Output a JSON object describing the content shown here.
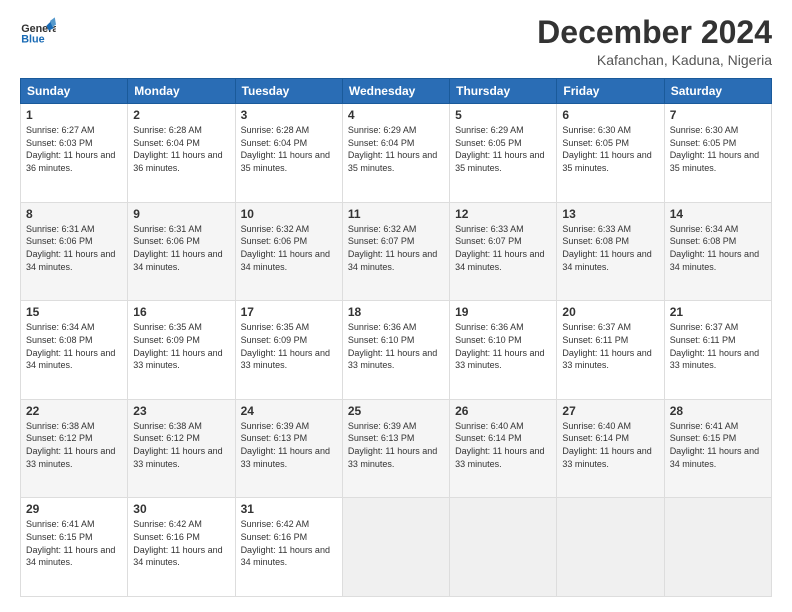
{
  "header": {
    "logo_line1": "General",
    "logo_line2": "Blue",
    "month": "December 2024",
    "location": "Kafanchan, Kaduna, Nigeria"
  },
  "days_of_week": [
    "Sunday",
    "Monday",
    "Tuesday",
    "Wednesday",
    "Thursday",
    "Friday",
    "Saturday"
  ],
  "weeks": [
    [
      {
        "day": "1",
        "sunrise": "6:27 AM",
        "sunset": "6:03 PM",
        "daylight": "11 hours and 36 minutes."
      },
      {
        "day": "2",
        "sunrise": "6:28 AM",
        "sunset": "6:04 PM",
        "daylight": "11 hours and 36 minutes."
      },
      {
        "day": "3",
        "sunrise": "6:28 AM",
        "sunset": "6:04 PM",
        "daylight": "11 hours and 35 minutes."
      },
      {
        "day": "4",
        "sunrise": "6:29 AM",
        "sunset": "6:04 PM",
        "daylight": "11 hours and 35 minutes."
      },
      {
        "day": "5",
        "sunrise": "6:29 AM",
        "sunset": "6:05 PM",
        "daylight": "11 hours and 35 minutes."
      },
      {
        "day": "6",
        "sunrise": "6:30 AM",
        "sunset": "6:05 PM",
        "daylight": "11 hours and 35 minutes."
      },
      {
        "day": "7",
        "sunrise": "6:30 AM",
        "sunset": "6:05 PM",
        "daylight": "11 hours and 35 minutes."
      }
    ],
    [
      {
        "day": "8",
        "sunrise": "6:31 AM",
        "sunset": "6:06 PM",
        "daylight": "11 hours and 34 minutes."
      },
      {
        "day": "9",
        "sunrise": "6:31 AM",
        "sunset": "6:06 PM",
        "daylight": "11 hours and 34 minutes."
      },
      {
        "day": "10",
        "sunrise": "6:32 AM",
        "sunset": "6:06 PM",
        "daylight": "11 hours and 34 minutes."
      },
      {
        "day": "11",
        "sunrise": "6:32 AM",
        "sunset": "6:07 PM",
        "daylight": "11 hours and 34 minutes."
      },
      {
        "day": "12",
        "sunrise": "6:33 AM",
        "sunset": "6:07 PM",
        "daylight": "11 hours and 34 minutes."
      },
      {
        "day": "13",
        "sunrise": "6:33 AM",
        "sunset": "6:08 PM",
        "daylight": "11 hours and 34 minutes."
      },
      {
        "day": "14",
        "sunrise": "6:34 AM",
        "sunset": "6:08 PM",
        "daylight": "11 hours and 34 minutes."
      }
    ],
    [
      {
        "day": "15",
        "sunrise": "6:34 AM",
        "sunset": "6:08 PM",
        "daylight": "11 hours and 34 minutes."
      },
      {
        "day": "16",
        "sunrise": "6:35 AM",
        "sunset": "6:09 PM",
        "daylight": "11 hours and 33 minutes."
      },
      {
        "day": "17",
        "sunrise": "6:35 AM",
        "sunset": "6:09 PM",
        "daylight": "11 hours and 33 minutes."
      },
      {
        "day": "18",
        "sunrise": "6:36 AM",
        "sunset": "6:10 PM",
        "daylight": "11 hours and 33 minutes."
      },
      {
        "day": "19",
        "sunrise": "6:36 AM",
        "sunset": "6:10 PM",
        "daylight": "11 hours and 33 minutes."
      },
      {
        "day": "20",
        "sunrise": "6:37 AM",
        "sunset": "6:11 PM",
        "daylight": "11 hours and 33 minutes."
      },
      {
        "day": "21",
        "sunrise": "6:37 AM",
        "sunset": "6:11 PM",
        "daylight": "11 hours and 33 minutes."
      }
    ],
    [
      {
        "day": "22",
        "sunrise": "6:38 AM",
        "sunset": "6:12 PM",
        "daylight": "11 hours and 33 minutes."
      },
      {
        "day": "23",
        "sunrise": "6:38 AM",
        "sunset": "6:12 PM",
        "daylight": "11 hours and 33 minutes."
      },
      {
        "day": "24",
        "sunrise": "6:39 AM",
        "sunset": "6:13 PM",
        "daylight": "11 hours and 33 minutes."
      },
      {
        "day": "25",
        "sunrise": "6:39 AM",
        "sunset": "6:13 PM",
        "daylight": "11 hours and 33 minutes."
      },
      {
        "day": "26",
        "sunrise": "6:40 AM",
        "sunset": "6:14 PM",
        "daylight": "11 hours and 33 minutes."
      },
      {
        "day": "27",
        "sunrise": "6:40 AM",
        "sunset": "6:14 PM",
        "daylight": "11 hours and 33 minutes."
      },
      {
        "day": "28",
        "sunrise": "6:41 AM",
        "sunset": "6:15 PM",
        "daylight": "11 hours and 34 minutes."
      }
    ],
    [
      {
        "day": "29",
        "sunrise": "6:41 AM",
        "sunset": "6:15 PM",
        "daylight": "11 hours and 34 minutes."
      },
      {
        "day": "30",
        "sunrise": "6:42 AM",
        "sunset": "6:16 PM",
        "daylight": "11 hours and 34 minutes."
      },
      {
        "day": "31",
        "sunrise": "6:42 AM",
        "sunset": "6:16 PM",
        "daylight": "11 hours and 34 minutes."
      },
      null,
      null,
      null,
      null
    ]
  ],
  "labels": {
    "sunrise": "Sunrise:",
    "sunset": "Sunset:",
    "daylight": "Daylight:"
  }
}
